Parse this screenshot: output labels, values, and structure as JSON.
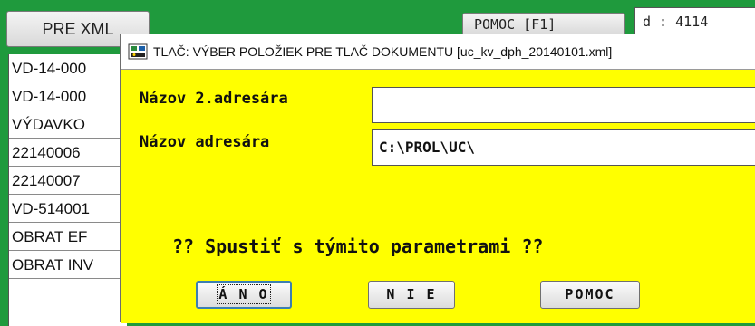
{
  "background": {
    "xml_button_label": "PRE XML",
    "help_button_label": "POMOC [F1]",
    "right_field_text": "d : 4114",
    "list_rows": [
      "VD-14-000",
      "VD-14-000",
      "VÝDAVKO",
      "22140006",
      "22140007",
      "VD-514001",
      "OBRAT EF",
      "OBRAT INV"
    ]
  },
  "dialog": {
    "title": "TLAČ: VÝBER POLOŽIEK PRE TLAČ DOKUMENTU [uc_kv_dph_20140101.xml]",
    "fields": {
      "second_directory_label": "Názov 2.adresára",
      "second_directory_value": "",
      "directory_label": "Názov adresára",
      "directory_value": "C:\\PROL\\UC\\"
    },
    "question": "?? Spustiť s týmito parametrami ??",
    "buttons": {
      "yes": "Á N O",
      "no": "N I E",
      "help": "POMOC"
    }
  },
  "colors": {
    "dialog_bg": "#ffff00",
    "window_bg": "#1f9a3d",
    "focus_border": "#3c7fb1"
  }
}
